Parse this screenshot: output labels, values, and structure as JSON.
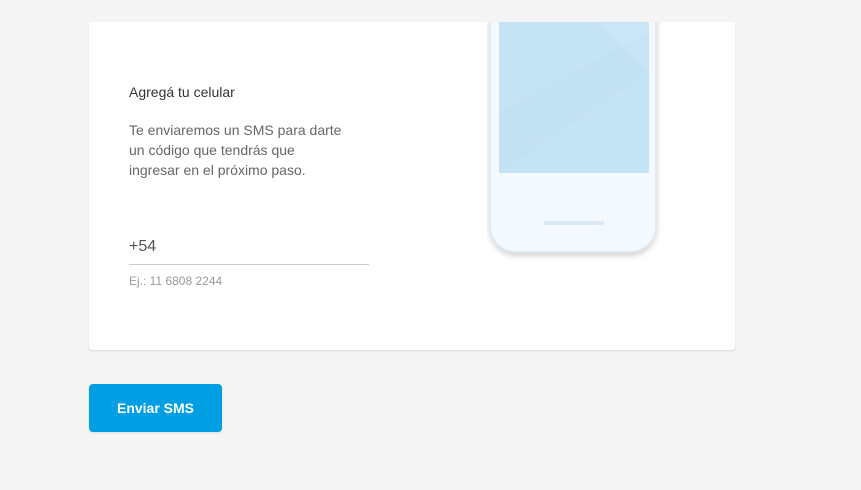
{
  "card": {
    "title": "Agregá tu celular",
    "description": "Te enviaremos un SMS para darte un código que tendrás que ingresar en el próximo paso.",
    "phone": {
      "prefix": "+54",
      "value": "",
      "placeholder": "",
      "helper": "Ej.: 11 6808 2244"
    }
  },
  "actions": {
    "send_label": "Enviar SMS"
  },
  "colors": {
    "background": "#f5f5f5",
    "card": "#ffffff",
    "primary": "#009ee3",
    "screen": "#c4e3f5"
  },
  "illustration": {
    "icon": "smartphone-icon"
  }
}
